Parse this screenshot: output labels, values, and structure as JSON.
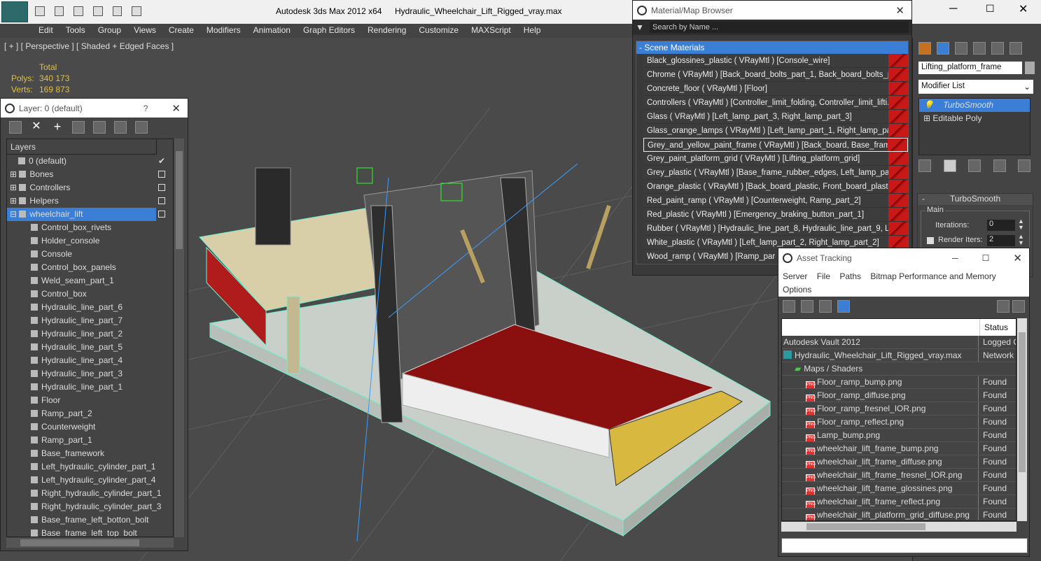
{
  "title": {
    "app": "Autodesk 3ds Max  2012 x64",
    "file": "Hydraulic_Wheelchair_Lift_Rigged_vray.max"
  },
  "menu": [
    "Edit",
    "Tools",
    "Group",
    "Views",
    "Create",
    "Modifiers",
    "Animation",
    "Graph Editors",
    "Rendering",
    "Customize",
    "MAXScript",
    "Help"
  ],
  "viewport": {
    "label": "[ + ] [ Perspective ] [ Shaded + Edged Faces ]",
    "total": "Total",
    "polys_label": "Polys:",
    "polys": "340 173",
    "verts_label": "Verts:",
    "verts": "169 873"
  },
  "layer": {
    "title": "Layer: 0 (default)",
    "help": "?",
    "header": "Layers",
    "top": [
      {
        "label": "0 (default)"
      },
      {
        "label": "Bones"
      },
      {
        "label": "Controllers"
      },
      {
        "label": "Helpers"
      },
      {
        "label": "wheelchair_lift"
      }
    ],
    "items": [
      "Control_box_rivets",
      "Holder_console",
      "Console",
      "Control_box_panels",
      "Weld_seam_part_1",
      "Control_box",
      "Hydraulic_line_part_6",
      "Hydraulic_line_part_7",
      "Hydraulic_line_part_2",
      "Hydraulic_line_part_5",
      "Hydraulic_line_part_4",
      "Hydraulic_line_part_3",
      "Hydraulic_line_part_1",
      "Floor",
      "Ramp_part_2",
      "Counterweight",
      "Ramp_part_1",
      "Base_framework",
      "Left_hydraulic_cylinder_part_1",
      "Left_hydraulic_cylinder_part_4",
      "Right_hydraulic_cylinder_part_1",
      "Right_hydraulic_cylinder_part_3",
      "Base_frame_left_botton_bolt",
      "Base_frame_left_top_bolt"
    ]
  },
  "matbrowser": {
    "title": "Material/Map Browser",
    "search": "Search by Name ...",
    "section": "- Scene Materials",
    "items": [
      "Black_glossines_plastic ( VRayMtl ) [Console_wire]",
      "Chrome ( VRayMtl ) [Back_board_bolts_part_1, Back_board_bolts_p...",
      "Concrete_floor  ( VRayMtl ) [Floor]",
      "Controllers ( VRayMtl ) [Controller_limit_folding, Controller_limit_lifti...",
      "Glass  ( VRayMtl ) [Left_lamp_part_3, Right_lamp_part_3]",
      "Glass_orange_lamps  ( VRayMtl ) [Left_lamp_part_1, Right_lamp_pa...",
      "Grey_and_yellow_paint_frame  ( VRayMtl ) [Back_board, Base_frame...",
      "Grey_paint_platform_grid  ( VRayMtl ) [Lifting_platform_grid]",
      "Grey_plastic  ( VRayMtl ) [Base_frame_rubber_edges, Left_lamp_par...",
      "Orange_plastic ( VRayMtl ) [Back_board_plastic, Front_board_plastic...",
      "Red_paint_ramp  ( VRayMtl ) [Counterweight, Ramp_part_2]",
      "Red_plastic  ( VRayMtl ) [Emergency_braking_button_part_1]",
      "Rubber  ( VRayMtl ) [Hydraulic_line_part_8, Hydraulic_line_part_9, L...",
      "White_plastic  ( VRayMtl ) [Left_lamp_part_2, Right_lamp_part_2]",
      "Wood_ramp  ( VRayMtl ) [Ramp_par"
    ]
  },
  "modifier": {
    "object": "Lifting_platform_frame",
    "list": "Modifier List",
    "stack": [
      "TurboSmooth",
      "Editable Poly"
    ],
    "rollout": "TurboSmooth",
    "main": "Main",
    "iter_label": "Iterations:",
    "iter": "0",
    "render_label": "Render Iters:",
    "render": "2"
  },
  "asset": {
    "title": "Asset Tracking",
    "menu": [
      "Server",
      "File",
      "Paths",
      "Bitmap Performance and Memory",
      "Options"
    ],
    "status_header": "Status",
    "rows": [
      {
        "name": "Autodesk Vault 2012",
        "status": "Logged O"
      },
      {
        "name": "Hydraulic_Wheelchair_Lift_Rigged_vray.max",
        "status": "Network"
      },
      {
        "name": "Maps / Shaders",
        "status": ""
      },
      {
        "name": "Floor_ramp_bump.png",
        "status": "Found"
      },
      {
        "name": "Floor_ramp_diffuse.png",
        "status": "Found"
      },
      {
        "name": "Floor_ramp_fresnel_IOR.png",
        "status": "Found"
      },
      {
        "name": "Floor_ramp_reflect.png",
        "status": "Found"
      },
      {
        "name": "Lamp_bump.png",
        "status": "Found"
      },
      {
        "name": "wheelchair_lift_frame_bump.png",
        "status": "Found"
      },
      {
        "name": "wheelchair_lift_frame_diffuse.png",
        "status": "Found"
      },
      {
        "name": "wheelchair_lift_frame_fresnel_IOR.png",
        "status": "Found"
      },
      {
        "name": "wheelchair_lift_frame_glossines.png",
        "status": "Found"
      },
      {
        "name": "wheelchair_lift_frame_reflect.png",
        "status": "Found"
      },
      {
        "name": "wheelchair_lift_platform_grid_diffuse.png",
        "status": "Found"
      }
    ]
  },
  "colors": {
    "accent": "#3a7fd5",
    "red": "#c81818"
  }
}
